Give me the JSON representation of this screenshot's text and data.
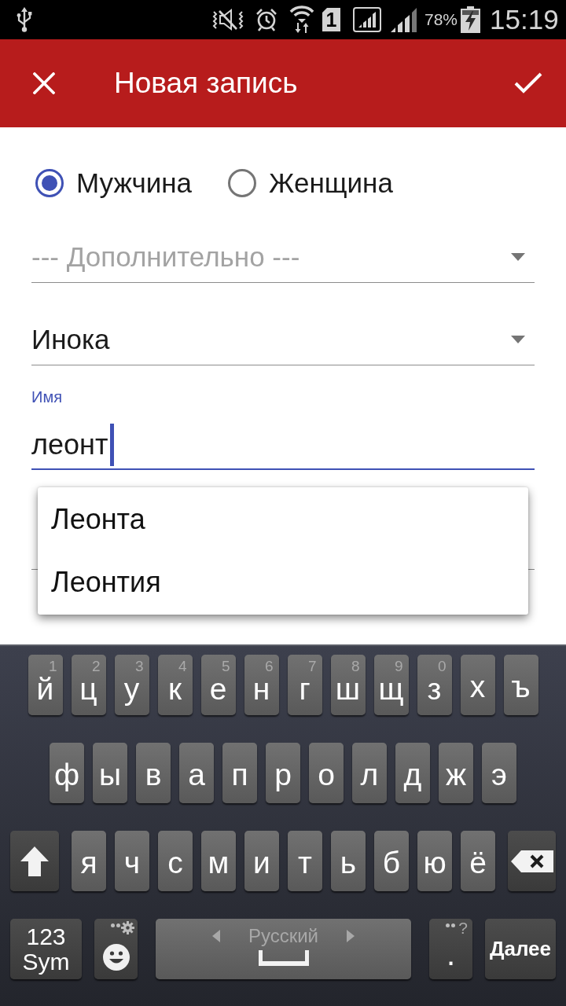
{
  "status_bar": {
    "sim": "1",
    "battery": "78%",
    "time": "15:19"
  },
  "app_bar": {
    "title": "Новая запись"
  },
  "gender": [
    {
      "label": "Мужчина",
      "selected": true
    },
    {
      "label": "Женщина",
      "selected": false
    }
  ],
  "dropdowns": [
    {
      "placeholder": "--- Дополнительно ---"
    },
    {
      "value": "Инока"
    }
  ],
  "name_field": {
    "label": "Имя",
    "value": "леонт",
    "focused": true
  },
  "suggestions": [
    "Леонта",
    "Леонтия"
  ],
  "keyboard": {
    "letter_rows": [
      [
        {
          "kind": "letter",
          "label": "й",
          "hint": "1"
        },
        {
          "kind": "letter",
          "label": "ц",
          "hint": "2"
        },
        {
          "kind": "letter",
          "label": "у",
          "hint": "3"
        },
        {
          "kind": "letter",
          "label": "к",
          "hint": "4"
        },
        {
          "kind": "letter",
          "label": "е",
          "hint": "5"
        },
        {
          "kind": "letter",
          "label": "н",
          "hint": "6"
        },
        {
          "kind": "letter",
          "label": "г",
          "hint": "7"
        },
        {
          "kind": "letter",
          "label": "ш",
          "hint": "8"
        },
        {
          "kind": "letter",
          "label": "щ",
          "hint": "9"
        },
        {
          "kind": "letter",
          "label": "з",
          "hint": "0"
        },
        {
          "kind": "letter",
          "label": "х"
        },
        {
          "kind": "letter",
          "label": "ъ"
        }
      ],
      [
        {
          "kind": "letter",
          "label": "ф"
        },
        {
          "kind": "letter",
          "label": "ы"
        },
        {
          "kind": "letter",
          "label": "в"
        },
        {
          "kind": "letter",
          "label": "а"
        },
        {
          "kind": "letter",
          "label": "п"
        },
        {
          "kind": "letter",
          "label": "р"
        },
        {
          "kind": "letter",
          "label": "о"
        },
        {
          "kind": "letter",
          "label": "л"
        },
        {
          "kind": "letter",
          "label": "д"
        },
        {
          "kind": "letter",
          "label": "ж"
        },
        {
          "kind": "letter",
          "label": "э"
        }
      ],
      [
        {
          "kind": "shift"
        },
        {
          "kind": "letter",
          "label": "я"
        },
        {
          "kind": "letter",
          "label": "ч"
        },
        {
          "kind": "letter",
          "label": "с"
        },
        {
          "kind": "letter",
          "label": "м"
        },
        {
          "kind": "letter",
          "label": "и"
        },
        {
          "kind": "letter",
          "label": "т"
        },
        {
          "kind": "letter",
          "label": "ь"
        },
        {
          "kind": "letter",
          "label": "б"
        },
        {
          "kind": "letter",
          "label": "ю"
        },
        {
          "kind": "letter",
          "label": "ё"
        },
        {
          "kind": "backspace"
        }
      ]
    ],
    "function_row": [
      {
        "kind": "symbols",
        "label": "123 Sym"
      },
      {
        "kind": "emoji"
      },
      {
        "kind": "space",
        "label": "Русский"
      },
      {
        "kind": "period",
        "label": ".",
        "hint": "?"
      },
      {
        "kind": "action",
        "label": "Далее"
      }
    ]
  }
}
